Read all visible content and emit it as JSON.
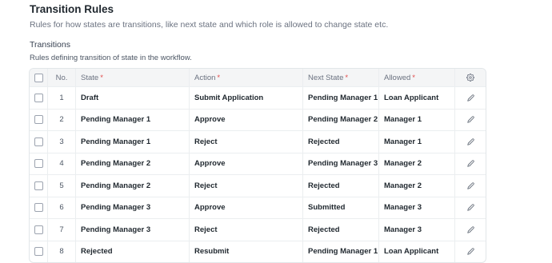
{
  "section": {
    "title": "Transition Rules",
    "description": "Rules for how states are transitions, like next state and which role is allowed to change state etc."
  },
  "field": {
    "label": "Transitions",
    "description": "Rules defining transition of state in the workflow."
  },
  "table": {
    "columns": {
      "no": "No.",
      "state": "State",
      "action": "Action",
      "next_state": "Next State",
      "allowed": "Allowed",
      "required_mark": "*"
    },
    "rows": [
      {
        "no": "1",
        "state": "Draft",
        "action": "Submit Application",
        "next_state": "Pending Manager 1",
        "allowed": "Loan Applicant"
      },
      {
        "no": "2",
        "state": "Pending Manager 1",
        "action": "Approve",
        "next_state": "Pending Manager 2",
        "allowed": "Manager 1"
      },
      {
        "no": "3",
        "state": "Pending Manager 1",
        "action": "Reject",
        "next_state": "Rejected",
        "allowed": "Manager 1"
      },
      {
        "no": "4",
        "state": "Pending Manager 2",
        "action": "Approve",
        "next_state": "Pending Manager 3",
        "allowed": "Manager 2"
      },
      {
        "no": "5",
        "state": "Pending Manager 2",
        "action": "Reject",
        "next_state": "Rejected",
        "allowed": "Manager 2"
      },
      {
        "no": "6",
        "state": "Pending Manager 3",
        "action": "Approve",
        "next_state": "Submitted",
        "allowed": "Manager 3"
      },
      {
        "no": "7",
        "state": "Pending Manager 3",
        "action": "Reject",
        "next_state": "Rejected",
        "allowed": "Manager 3"
      },
      {
        "no": "8",
        "state": "Rejected",
        "action": "Resubmit",
        "next_state": "Pending Manager 1",
        "allowed": "Loan Applicant"
      }
    ]
  },
  "icons": {
    "settings": "gear-icon",
    "edit": "pencil-icon"
  },
  "colors": {
    "required": "#e24c4c",
    "header_bg": "#f4f5f6",
    "border": "#e2e6e9"
  }
}
